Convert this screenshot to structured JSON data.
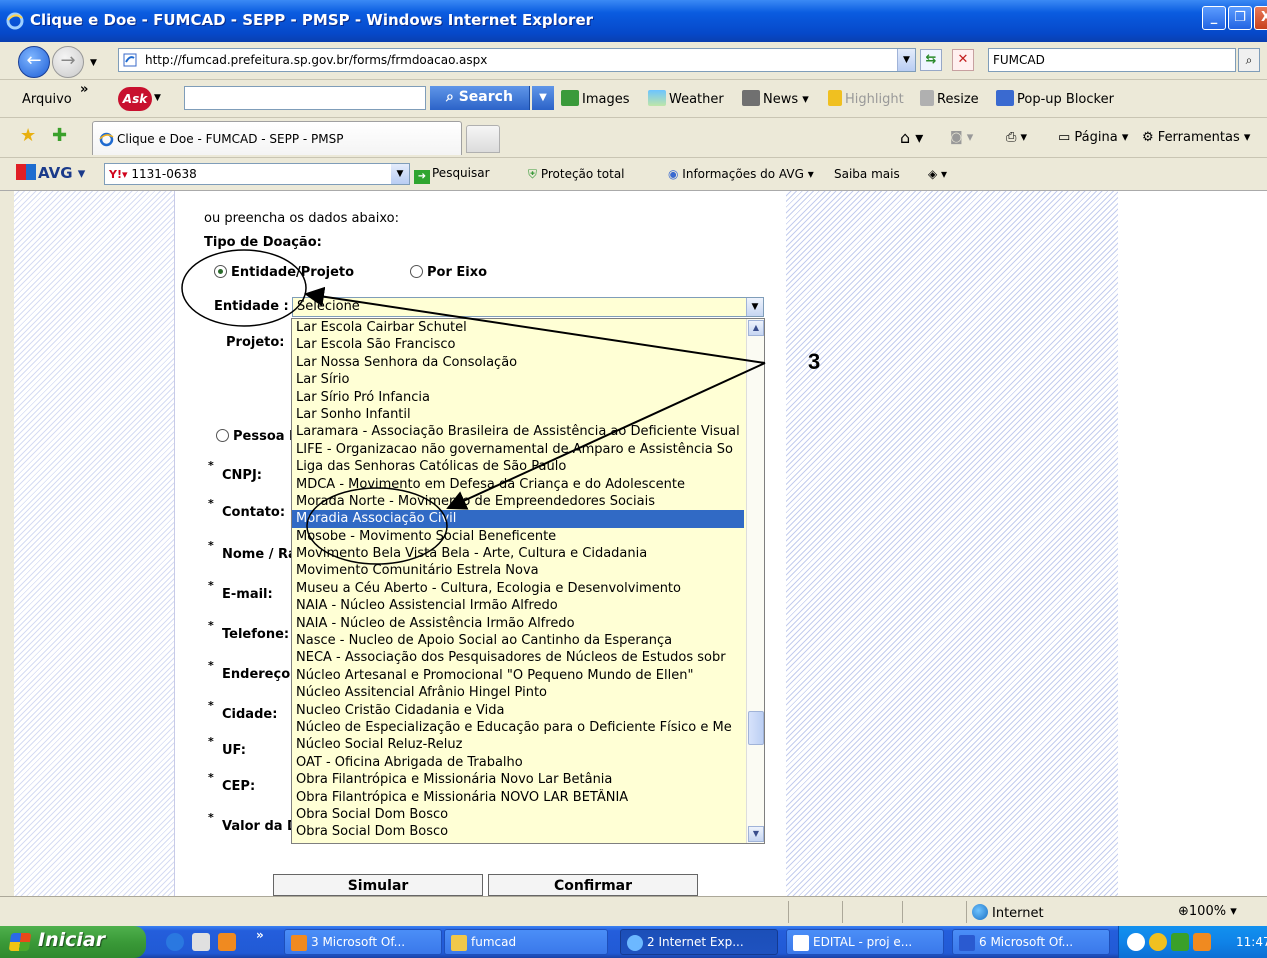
{
  "window": {
    "title": "Clique e Doe - FUMCAD - SEPP - PMSP - Windows Internet Explorer",
    "minimize": "_",
    "restore": "❐",
    "close": "X"
  },
  "address_bar": {
    "url": "http://fumcad.prefeitura.sp.gov.br/forms/frmdoacao.aspx",
    "search_value": "FUMCAD"
  },
  "menu": {
    "arquivo": "Arquivo",
    "more": "»"
  },
  "ask_toolbar": {
    "logo": "Ask",
    "search_label": "Search",
    "images": "Images",
    "weather": "Weather",
    "news": "News ▾",
    "highlight": "Highlight",
    "resize": "Resize",
    "popup_blocker": "Pop-up Blocker"
  },
  "tabs": {
    "active_label": "Clique e Doe - FUMCAD - SEPP - PMSP",
    "pagina": "Página ▾",
    "ferramentas": "Ferramentas ▾"
  },
  "avg_toolbar": {
    "logo": "AVG",
    "yahoo_value": "1131-0638",
    "pesquisar": "Pesquisar",
    "protecao": "Proteção total",
    "informacoes": "Informações do AVG ▾",
    "saiba_mais": "Saiba mais"
  },
  "form": {
    "intro": "ou preencha os dados abaixo:",
    "tipo_doacao": "Tipo de Doação:",
    "radio_entidade": "Entidade/Projeto",
    "radio_eixo": "Por Eixo",
    "entidade_label": "Entidade :",
    "projeto_label": "Projeto:",
    "pessoa_label": "Pessoa F",
    "cnpj_label": "CNPJ:",
    "contato_label": "Contato:",
    "nome_label": "Nome / Ra",
    "email_label": "E-mail:",
    "telefone_label": "Telefone:",
    "endereco_label": "Endereço:",
    "cidade_label": "Cidade:",
    "uf_label": "UF:",
    "cep_label": "CEP:",
    "valor_label": "Valor da D",
    "required_mark": "*",
    "select_value": "Selecione",
    "options": [
      "Lar Escola Cairbar Schutel",
      "Lar Escola São Francisco",
      "Lar Nossa Senhora da Consolação",
      "Lar Sírio",
      "Lar Sírio Pró Infancia",
      "Lar Sonho Infantil",
      "Laramara - Associação Brasileira de Assistência ao Deficiente Visual",
      "LIFE - Organizacao não governamental de Amparo e Assistência So",
      "Liga das Senhoras Católicas de São Paulo",
      "MDCA - Movimento em Defesa da Criança e do Adolescente",
      "Morada Norte - Movimento de Empreendedores Sociais",
      "Moradia Associação Civil",
      "Mosobe - Movimento Social Beneficente",
      "Movimento Bela Vista Bela - Arte, Cultura e Cidadania",
      "Movimento Comunitário Estrela Nova",
      "Museu a Céu Aberto - Cultura, Ecologia e Desenvolvimento",
      "NAIA - Núcleo Assistencial Irmão Alfredo",
      "NAIA - Núcleo de Assistência Irmão Alfredo",
      "Nasce - Nucleo de Apoio Social ao Cantinho da Esperança",
      "NECA - Associação dos Pesquisadores de Núcleos de Estudos sobr",
      "Núcleo Artesanal e Promocional \"O Pequeno Mundo de Ellen\"",
      "Núcleo Assitencial Afrânio Hingel Pinto",
      "Nucleo Cristão Cidadania e Vida",
      "Núcleo de Especialização e Educação para o Deficiente Físico e Me",
      "Núcleo Social Reluz-Reluz",
      "OAT - Oficina Abrigada de Trabalho",
      "Obra Filantrópica e Missionária Novo Lar Betânia",
      "Obra Filantrópica e Missionária NOVO LAR BETÂNIA",
      "Obra Social Dom Bosco",
      "Obra Social Dom Bosco"
    ],
    "selected_index": 11,
    "simular": "Simular",
    "confirmar": "Confirmar"
  },
  "annotation": {
    "number": "3"
  },
  "status_bar": {
    "zone": "Internet",
    "zoom": "100%"
  },
  "taskbar": {
    "start": "Iniciar",
    "tasks": [
      "3 Microsoft Of...",
      "fumcad",
      "2 Internet Exp...",
      "EDITAL - proj e...",
      "6 Microsoft Of..."
    ],
    "clock": "11:47"
  }
}
